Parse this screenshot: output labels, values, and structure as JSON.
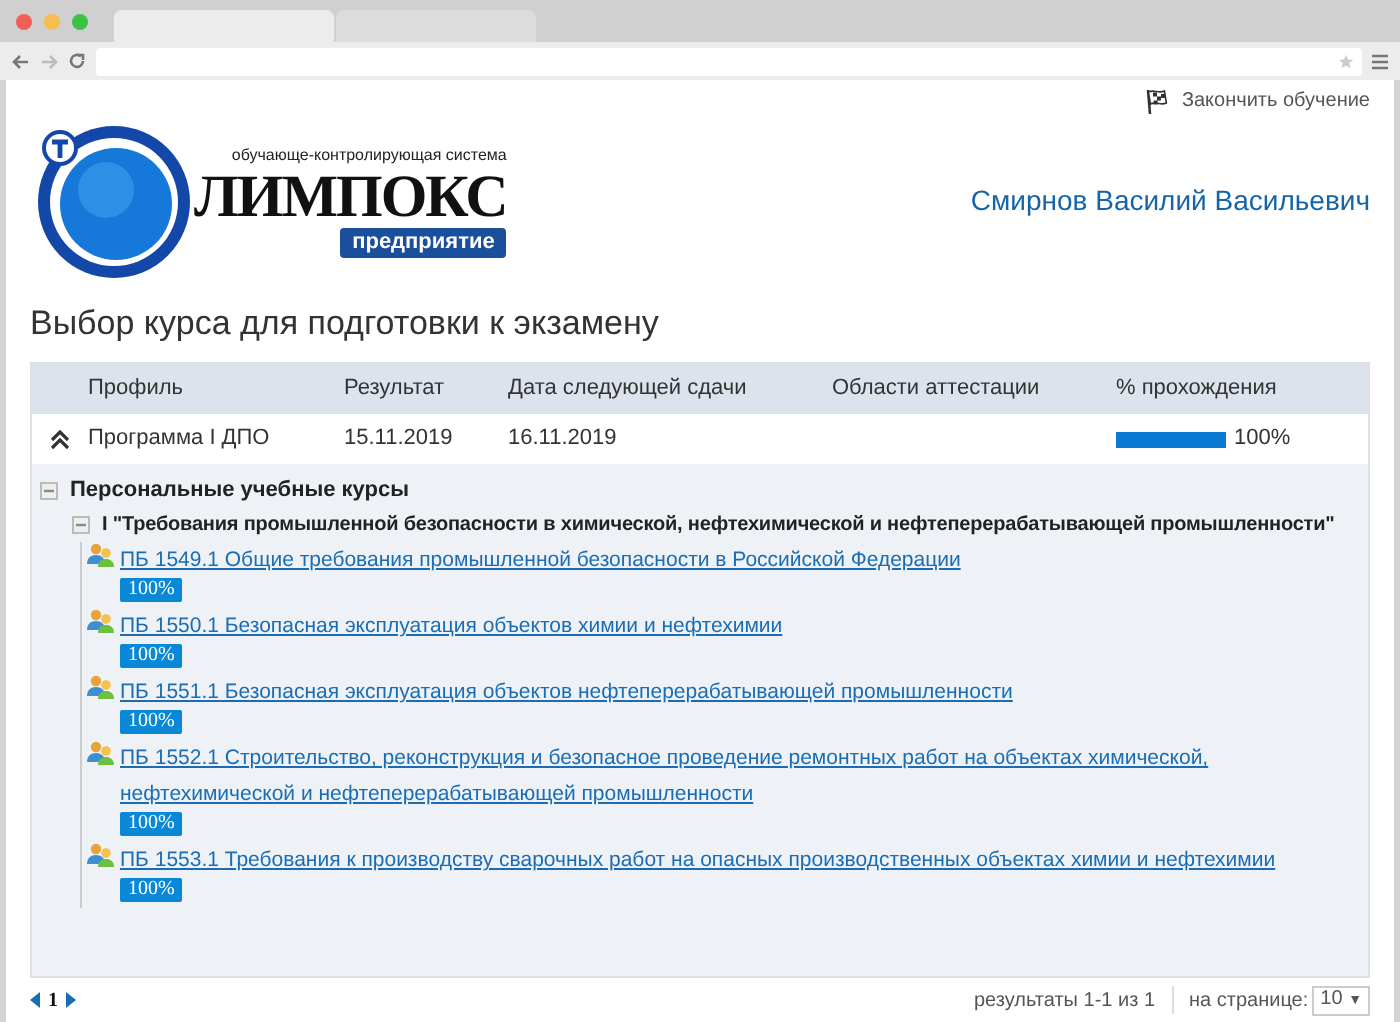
{
  "finish_link": "Закончить обучение",
  "logo": {
    "tagline": "обучающе-контролирующая система",
    "name": "ЛИМПОКС",
    "badge": "предприятие"
  },
  "user_name": "Смирнов Василий Васильевич",
  "page_title": "Выбор курса для подготовки к экзамену",
  "table": {
    "columns": [
      "Профиль",
      "Результат",
      "Дата следующей сдачи",
      "Области аттестации",
      "% прохождения"
    ],
    "rows": [
      {
        "expanded": true,
        "profile": "Программа I ДПО",
        "result": "15.11.2019",
        "next_date": "16.11.2019",
        "level": 1,
        "percent": "100%"
      }
    ]
  },
  "tree": {
    "label": "Персональные учебные курсы",
    "expanded": true,
    "children": [
      {
        "label": "I \"Требования промышленной безопасности в химической, нефтехимической и нефтеперерабатывающей промышленности\"",
        "expanded": true,
        "children": [
          {
            "label": "ПБ 1549.1 Общие требования промышленной безопасности в Российской Федерации",
            "badge": "100%"
          },
          {
            "label": "ПБ 1550.1 Безопасная эксплуатация объектов химии и нефтехимии",
            "badge": "100%"
          },
          {
            "label": "ПБ 1551.1 Безопасная эксплуатация объектов нефтеперерабатывающей промышленности",
            "badge": "100%"
          },
          {
            "label": "ПБ 1552.1 Строительство, реконструкция и безопасное проведение ремонтных работ на объектах химической, нефтехимической и нефтеперерабатывающей промышленности",
            "badge": "100%"
          },
          {
            "label": "ПБ 1553.1 Требования к производству сварочных работ на опасных производственных объектах химии и нефтехимии",
            "badge": "100%"
          }
        ]
      }
    ]
  },
  "pagination": {
    "pages": [
      {
        "label": "1",
        "selected": true
      }
    ],
    "results": "результаты 1-1 из 1",
    "per_page_label": "на странице:",
    "per_page": "10",
    "per_page_arrow": "▼"
  }
}
